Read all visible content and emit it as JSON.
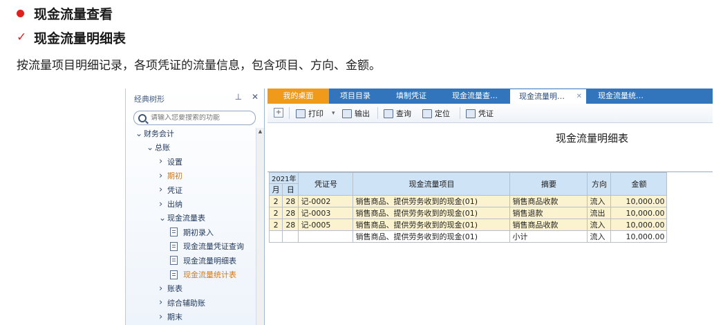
{
  "doc": {
    "heading1": "现金流量查看",
    "heading2": "现金流量明细表",
    "check_mark": "✓",
    "paragraph": "按流量项目明细记录，各项凭证的流量信息，包含项目、方向、金额。"
  },
  "sidebar": {
    "title": "经典树形",
    "pin": "⊥",
    "close": "✕",
    "search_placeholder": "请输入您要搜索的功能",
    "tree": [
      {
        "label": "财务会计",
        "level": 0,
        "state": "expanded"
      },
      {
        "label": "总账",
        "level": 1,
        "state": "expanded"
      },
      {
        "label": "设置",
        "level": 2,
        "state": "collapsed"
      },
      {
        "label": "期初",
        "level": 2,
        "state": "collapsed",
        "highlight": true
      },
      {
        "label": "凭证",
        "level": 2,
        "state": "collapsed"
      },
      {
        "label": "出纳",
        "level": 2,
        "state": "collapsed"
      },
      {
        "label": "现金流量表",
        "level": 2,
        "state": "expanded"
      },
      {
        "label": "期初录入",
        "level": 3,
        "state": "leaf"
      },
      {
        "label": "现金流量凭证查询",
        "level": 3,
        "state": "leaf"
      },
      {
        "label": "现金流量明细表",
        "level": 3,
        "state": "leaf"
      },
      {
        "label": "现金流量统计表",
        "level": 3,
        "state": "leaf",
        "highlight": true
      },
      {
        "label": "账表",
        "level": 2,
        "state": "collapsed"
      },
      {
        "label": "综合辅助账",
        "level": 2,
        "state": "collapsed"
      },
      {
        "label": "期末",
        "level": 2,
        "state": "collapsed"
      }
    ]
  },
  "tabs": [
    {
      "label": "我的桌面"
    },
    {
      "label": "项目目录"
    },
    {
      "label": "填制凭证"
    },
    {
      "label": "现金流量查…"
    },
    {
      "label": "现金流量明…",
      "active": true,
      "close": "✕"
    },
    {
      "label": "现金流量统…"
    }
  ],
  "toolbar": {
    "add": "+",
    "print": "打印",
    "print_dropdown": "▾",
    "export": "输出",
    "query": "查询",
    "locate": "定位",
    "voucher": "凭证"
  },
  "report": {
    "title": "现金流量明细表",
    "year": "2021年",
    "col_month": "月",
    "col_day": "日",
    "col_voucher": "凭证号",
    "col_item": "现金流量项目",
    "col_summary": "摘要",
    "col_direction": "方向",
    "col_amount": "金额",
    "rows": [
      {
        "month": "2",
        "day": "28",
        "voucher": "记-0002",
        "item": "销售商品、提供劳务收到的现金(01)",
        "summary": "销售商品收款",
        "direction": "流入",
        "amount": "10,000.00"
      },
      {
        "month": "2",
        "day": "28",
        "voucher": "记-0003",
        "item": "销售商品、提供劳务收到的现金(01)",
        "summary": "销售退款",
        "direction": "流出",
        "amount": "10,000.00"
      },
      {
        "month": "2",
        "day": "28",
        "voucher": "记-0005",
        "item": "销售商品、提供劳务收到的现金(01)",
        "summary": "销售商品收款",
        "direction": "流入",
        "amount": "10,000.00"
      }
    ],
    "subtotal": {
      "month": "",
      "day": "",
      "voucher": "",
      "item": "销售商品、提供劳务收到的现金(01)",
      "summary": "小计",
      "direction": "流入",
      "amount": "10,000.00"
    }
  }
}
